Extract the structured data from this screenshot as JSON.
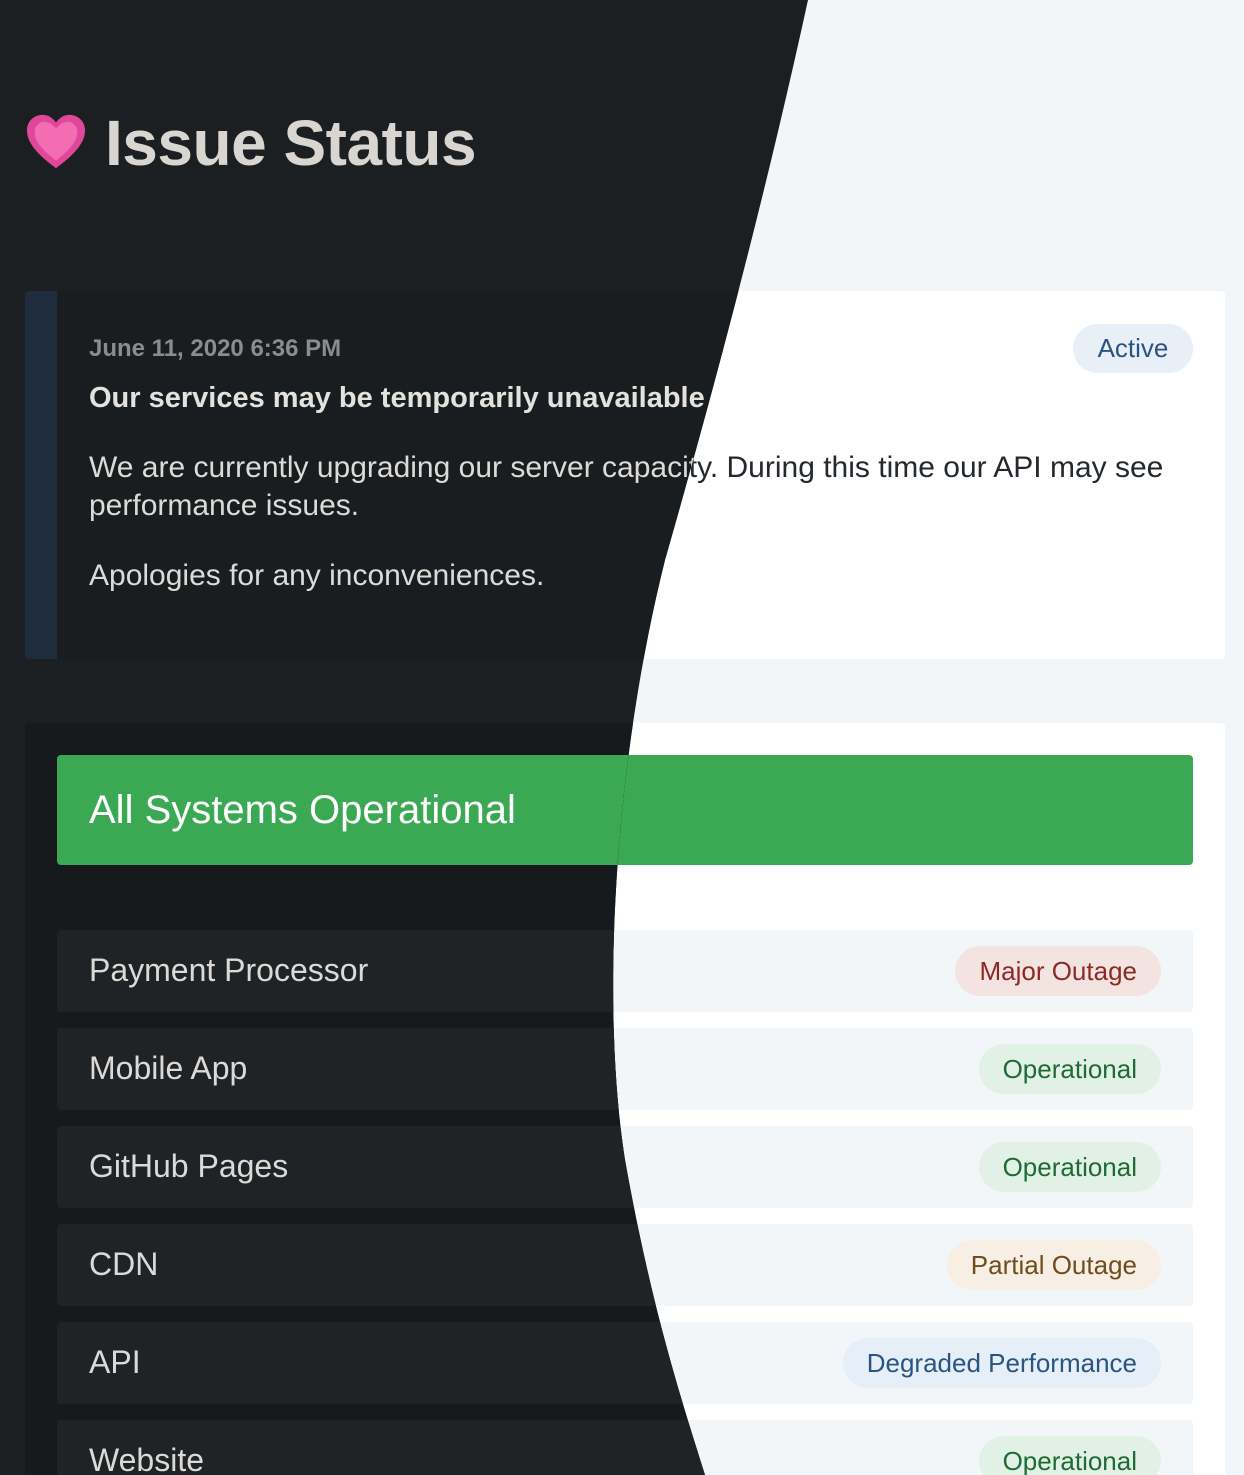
{
  "header": {
    "icon": "pink-heart-icon",
    "title": "Issue Status"
  },
  "incident": {
    "date": "June 11, 2020 6:36 PM",
    "status": "Active",
    "heading": "Our services may be temporarily unavailable",
    "body": [
      "We are currently upgrading our server capacity. During this time our API may see performance issues.",
      "Apologies for any inconveniences."
    ]
  },
  "summary": {
    "banner": "All Systems Operational"
  },
  "components": [
    {
      "name": "Payment Processor",
      "status": "Major Outage",
      "level": "major"
    },
    {
      "name": "Mobile App",
      "status": "Operational",
      "level": "operational"
    },
    {
      "name": "GitHub Pages",
      "status": "Operational",
      "level": "operational"
    },
    {
      "name": "CDN",
      "status": "Partial Outage",
      "level": "partial"
    },
    {
      "name": "API",
      "status": "Degraded Performance",
      "level": "degraded"
    },
    {
      "name": "Website",
      "status": "Operational",
      "level": "operational"
    }
  ],
  "colors": {
    "operational_banner": "#3ba853",
    "major_outage": "#8c2b25",
    "operational": "#1f6b34",
    "partial_outage": "#6e4e1f",
    "degraded_performance": "#2a5582",
    "dark_background": "#1c1f22",
    "light_background": "#f3f6f9"
  }
}
